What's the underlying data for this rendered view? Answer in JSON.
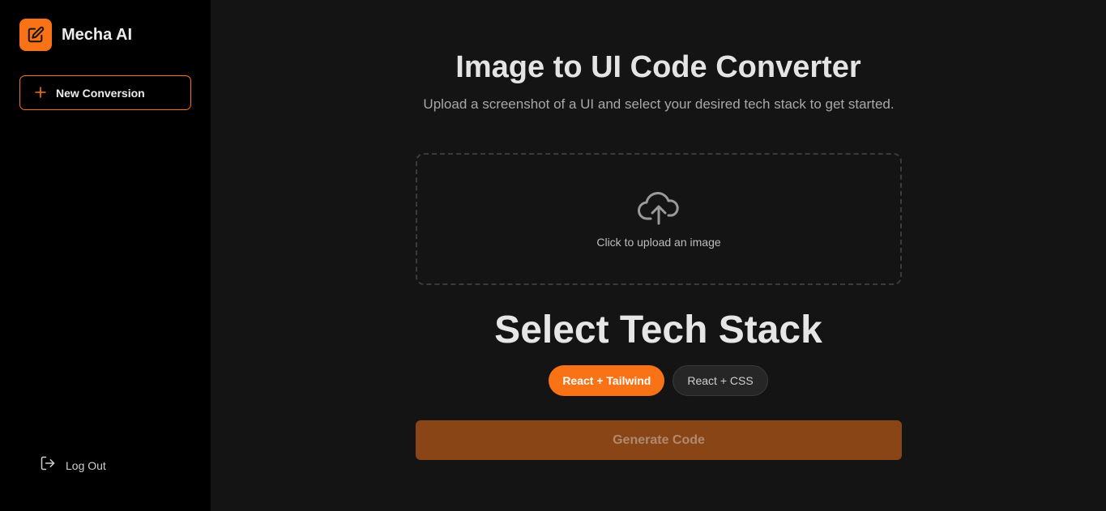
{
  "sidebar": {
    "brand": {
      "name": "Mecha AI",
      "logo_icon": "edit-square-icon"
    },
    "new_conversion": {
      "label": "New Conversion",
      "icon": "plus-icon"
    },
    "logout": {
      "label": "Log Out",
      "icon": "logout-icon"
    }
  },
  "main": {
    "title": "Image to UI Code Converter",
    "subtitle": "Upload a screenshot of a UI and select your desired tech stack to get started.",
    "upload": {
      "text": "Click to upload an image",
      "icon": "cloud-upload-icon"
    },
    "stack": {
      "title": "Select Tech Stack",
      "options": [
        {
          "label": "React + Tailwind",
          "selected": true
        },
        {
          "label": "React + CSS",
          "selected": false
        }
      ]
    },
    "generate_label": "Generate Code"
  },
  "colors": {
    "accent": "#f97316",
    "sidebar_bg": "#000000",
    "main_bg": "#141414",
    "generate_bg": "#8a4516"
  }
}
